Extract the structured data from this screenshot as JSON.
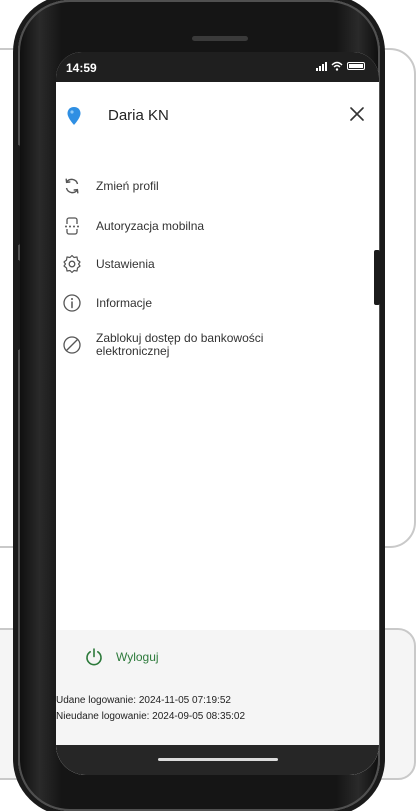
{
  "status_bar": {
    "time": "14:59",
    "signal_icon": "signal-bars-icon",
    "wifi_icon": "wifi-icon",
    "battery_icon": "battery-icon"
  },
  "header": {
    "profile_icon": "location-pin-icon",
    "profile_name": "Daria KN",
    "close_icon": "close-icon"
  },
  "menu": {
    "items": [
      {
        "label": "Zmień profil",
        "icon": "switch-profile-icon"
      },
      {
        "label": "Autoryzacja mobilna",
        "icon": "mobile-authorization-icon"
      },
      {
        "label": "Ustawienia",
        "icon": "settings-icon"
      },
      {
        "label": "Informacje",
        "icon": "info-icon"
      },
      {
        "label": "Zablokuj dostęp do bankowości elektronicznej",
        "icon": "block-icon"
      }
    ]
  },
  "footer": {
    "logout_label": "Wyloguj",
    "logout_icon": "power-icon",
    "successful_login": "Udane logowanie: 2024-11-05 07:19:52",
    "failed_login": "Nieudane logowanie: 2024-09-05 08:35:02"
  },
  "colors": {
    "accent_green": "#2d7a3b",
    "pin_blue": "#2f8fe3",
    "status_bar": "#1f1f1f"
  }
}
